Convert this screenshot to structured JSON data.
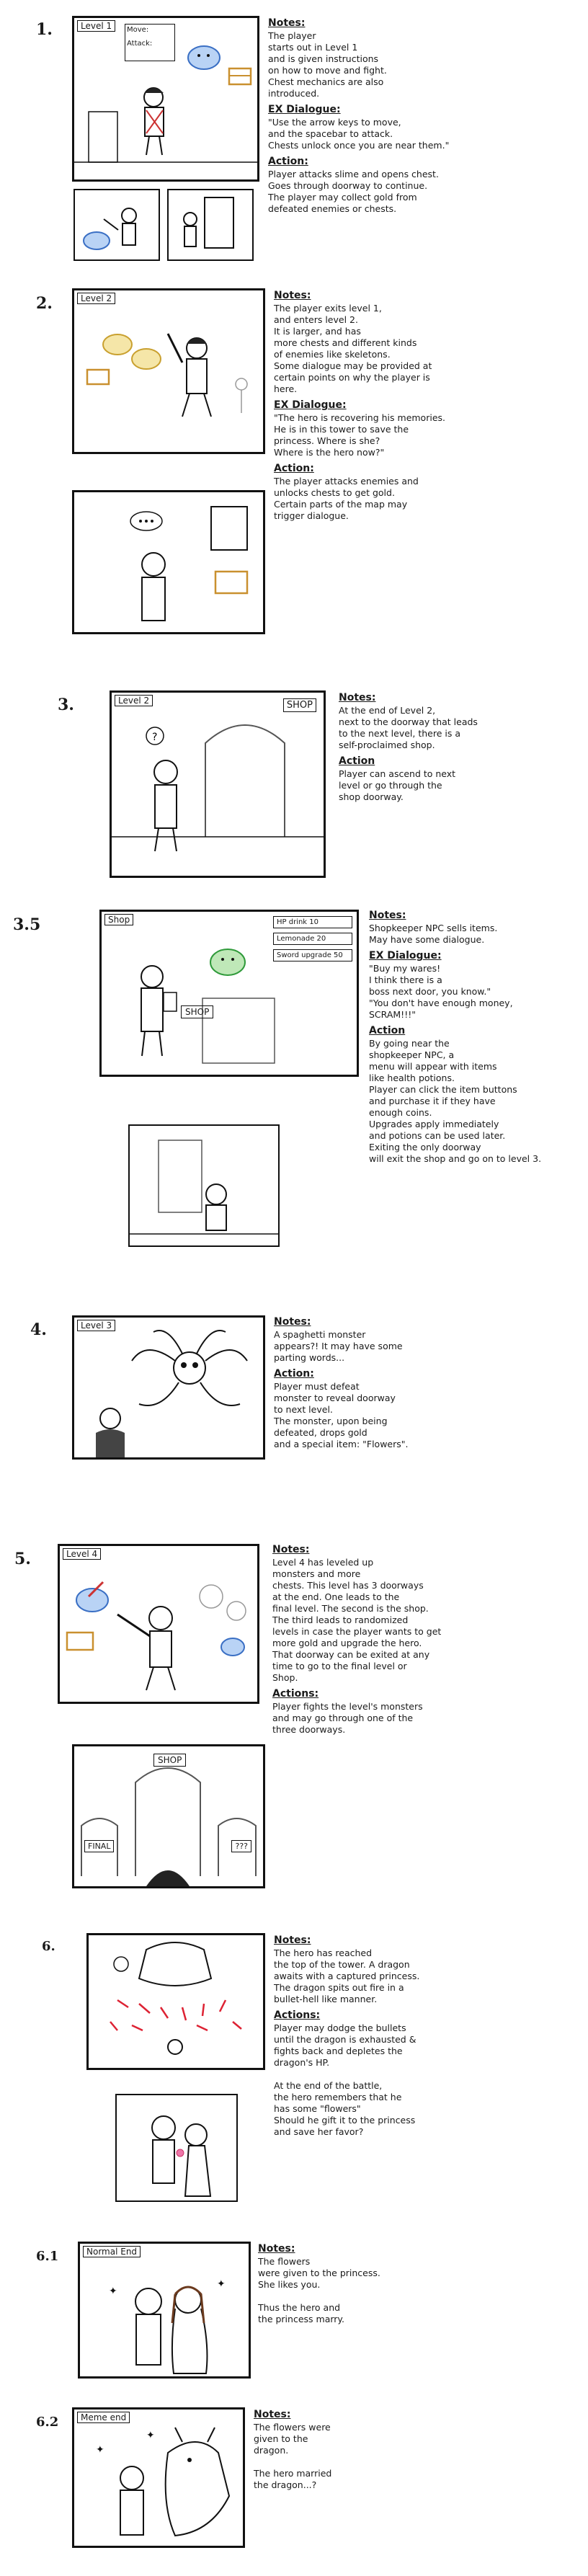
{
  "scenes": [
    {
      "number": "1.",
      "panel_label": "Level 1",
      "panel_texts": [
        "Move:",
        "Attack:"
      ],
      "notes_heading": "Notes:",
      "notes": "The player\nstarts out in Level 1\nand is given instructions\non how to move and fight.\nChest mechanics are also\nintroduced.",
      "dialogue_heading": "EX Dialogue:",
      "dialogue": "\"Use the arrow keys to move,\nand the spacebar to attack.\nChests unlock once you are near them.\"",
      "action_heading": "Action:",
      "action": "Player attacks slime and opens chest.\nGoes through doorway to continue.\nThe player may collect gold from\ndefeated enemies or chests."
    },
    {
      "number": "2.",
      "panel_label": "Level 2",
      "notes_heading": "Notes:",
      "notes": "The player exits level 1,\nand enters level 2.\nIt is larger, and has\nmore chests and different kinds\nof enemies like skeletons.\nSome dialogue may be provided at\ncertain points on why the player is\nhere.",
      "dialogue_heading": "EX Dialogue:",
      "dialogue": "\"The hero is recovering his memories.\nHe is in this tower to save the\nprincess. Where is she?\nWhere is the hero now?\"",
      "action_heading": "Action:",
      "action": "The player attacks enemies and\nunlocks chests to get gold.\nCertain parts of the map may\ntrigger dialogue."
    },
    {
      "number": "3.",
      "panel_label": "Level 2",
      "panel_texts": [
        "SHOP"
      ],
      "notes_heading": "Notes:",
      "notes": "At the end of Level 2,\nnext to the doorway that leads\nto the next level, there is a\nself-proclaimed shop.",
      "action_heading": "Action",
      "action": "Player can ascend to next\nlevel or go through the\nshop doorway."
    },
    {
      "number": "3.5",
      "panel_label": "Shop",
      "panel_texts": [
        "HP drink 10",
        "Lemonade 20",
        "Sword upgrade 50",
        "SHOP"
      ],
      "notes_heading": "Notes:",
      "notes": "Shopkeeper NPC sells items.\nMay have some dialogue.",
      "dialogue_heading": "EX Dialogue:",
      "dialogue": "\"Buy my wares!\nI think there is a\nboss next door, you know.\"\n\"You don't have enough money,\nSCRAM!!!\"",
      "action_heading": "Action",
      "action": "By going near the\nshopkeeper NPC, a\nmenu will appear with items\nlike health potions.\nPlayer can click the item buttons\nand purchase it if they have\nenough coins.\nUpgrades apply immediately\nand potions can be used later.\nExiting the only doorway\nwill exit the shop and go on to level 3."
    },
    {
      "number": "4.",
      "panel_label": "Level 3",
      "notes_heading": "Notes:",
      "notes": "A spaghetti monster\nappears?! It may have some\nparting words...",
      "action_heading": "Action:",
      "action": "Player must defeat\nmonster to reveal doorway\nto next level.\nThe monster, upon being\ndefeated, drops gold\nand a special item: \"Flowers\"."
    },
    {
      "number": "5.",
      "panel_label": "Level 4",
      "panel_texts": [
        "SHOP",
        "FINAL",
        "???"
      ],
      "notes_heading": "Notes:",
      "notes": "Level 4 has leveled up\nmonsters and more\nchests. This level has 3 doorways\nat the end. One leads to the\nfinal level. The second is the shop.\nThe third leads to randomized\nlevels in case the player wants to get\nmore gold and upgrade the hero.\nThat doorway can be exited at any\ntime to go to the final level or\nShop.",
      "action_heading": "Actions:",
      "action": "Player fights the level's monsters\nand may go through one of the\nthree doorways."
    },
    {
      "number": "6.",
      "notes_heading": "Notes:",
      "notes": "The hero has reached\nthe top of the tower. A dragon\nawaits with a captured princess.\nThe dragon spits out fire in a\nbullet-hell like manner.",
      "action_heading": "Actions:",
      "action": "Player may dodge the bullets\nuntil the dragon is exhausted &\nfights back and depletes the\ndragon's HP.\n\nAt the end of the battle,\nthe hero remembers that he\nhas some \"flowers\"\nShould he gift it to the princess\nand save her favor?"
    },
    {
      "number": "6.1",
      "panel_label": "Normal End",
      "notes_heading": "Notes:",
      "notes": "The flowers\nwere given to the princess.\nShe likes you.\n\nThus the hero and\nthe princess marry."
    },
    {
      "number": "6.2",
      "panel_label": "Meme end",
      "notes_heading": "Notes:",
      "notes": "The flowers were\ngiven to the\ndragon.\n\nThe hero married\nthe dragon...?"
    }
  ]
}
